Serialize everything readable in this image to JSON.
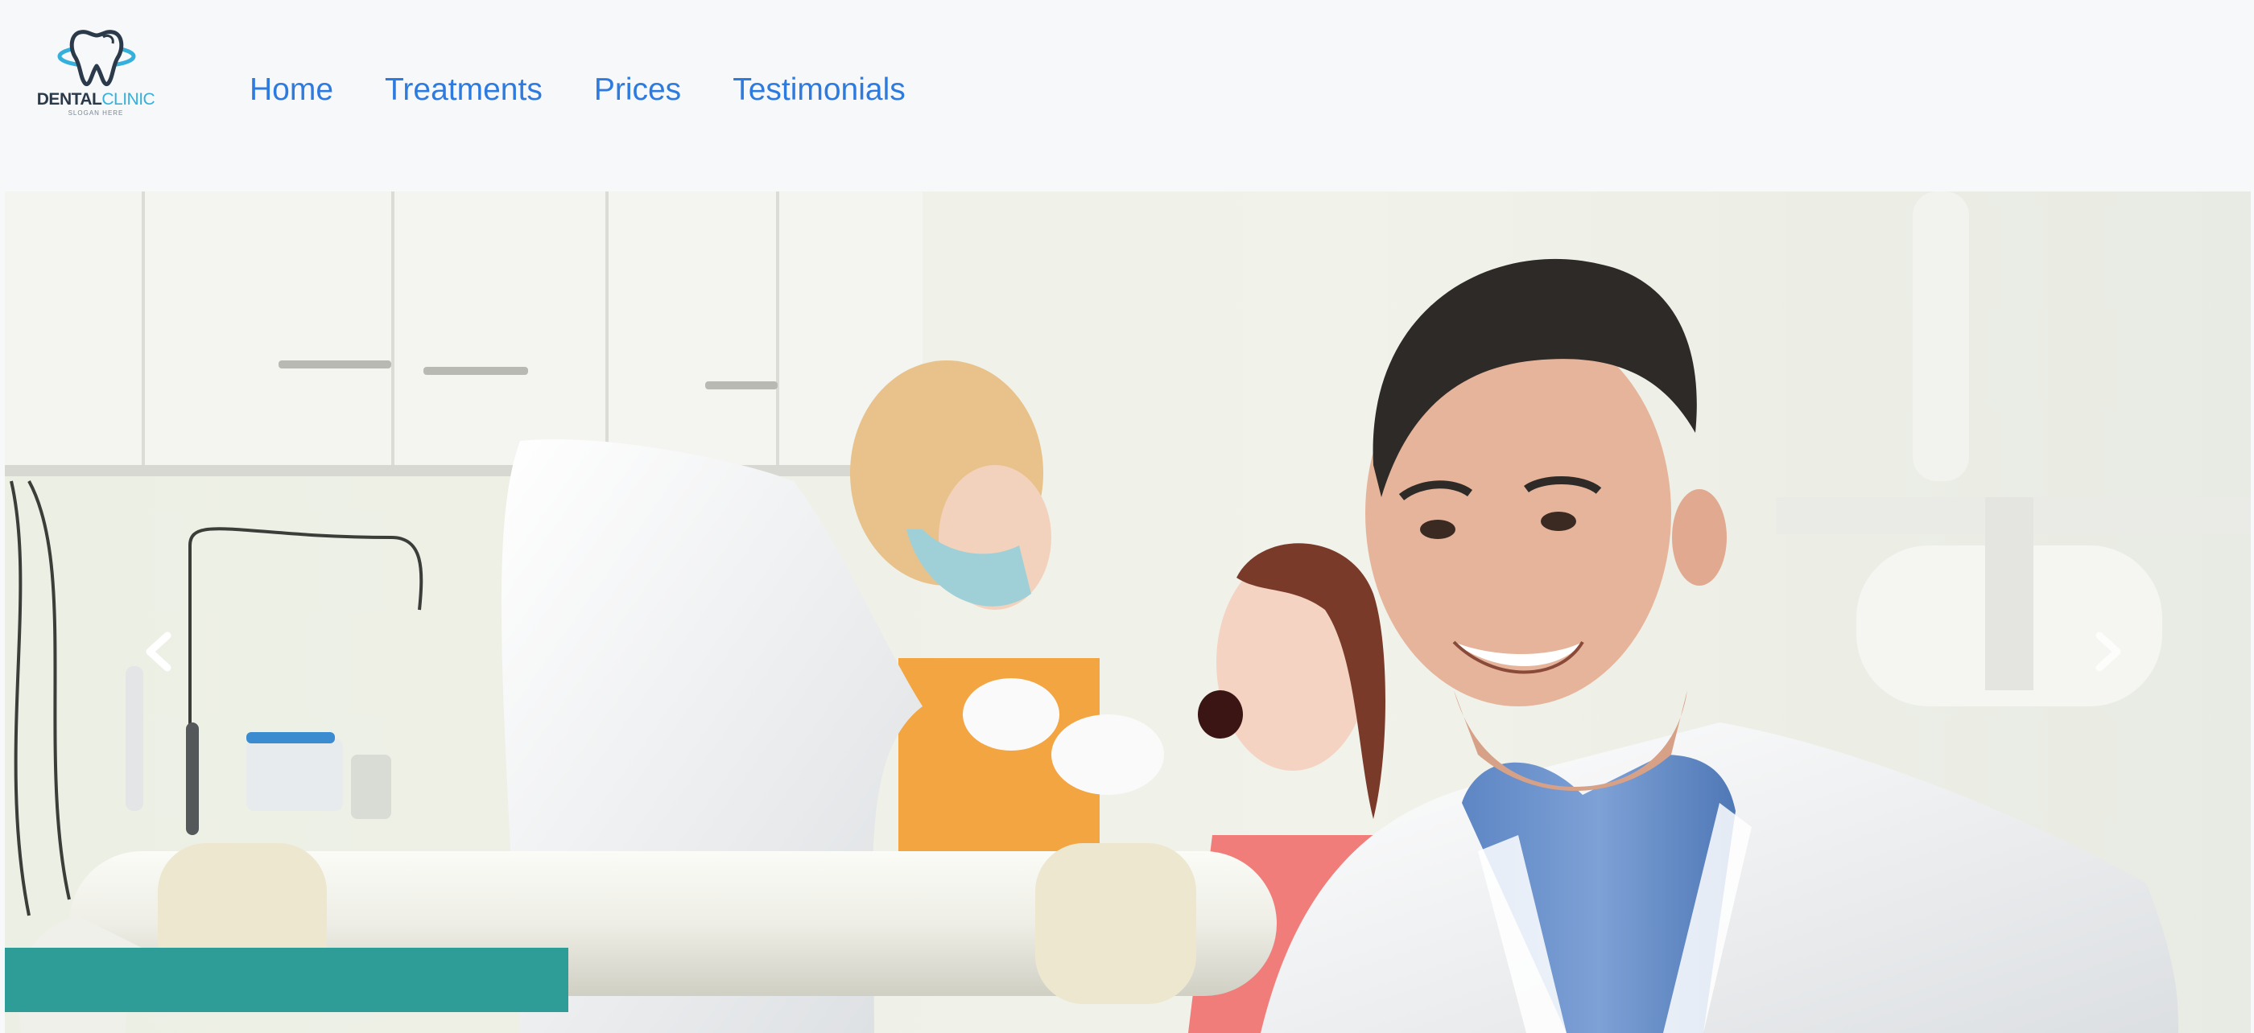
{
  "brand": {
    "word_dental": "DENTAL",
    "word_clinic": "CLINIC",
    "slogan": "SLOGAN HERE",
    "icon": "tooth-icon",
    "colors": {
      "dark": "#2b3a4a",
      "accent": "#35b0dc"
    }
  },
  "nav": {
    "items": [
      {
        "label": "Home"
      },
      {
        "label": "Treatments"
      },
      {
        "label": "Prices"
      },
      {
        "label": "Testimonials"
      }
    ],
    "link_color": "#2e7be0"
  },
  "hero": {
    "image": "dentist-clinic-photo",
    "prev_icon": "chevron-left-icon",
    "next_icon": "chevron-right-icon"
  }
}
